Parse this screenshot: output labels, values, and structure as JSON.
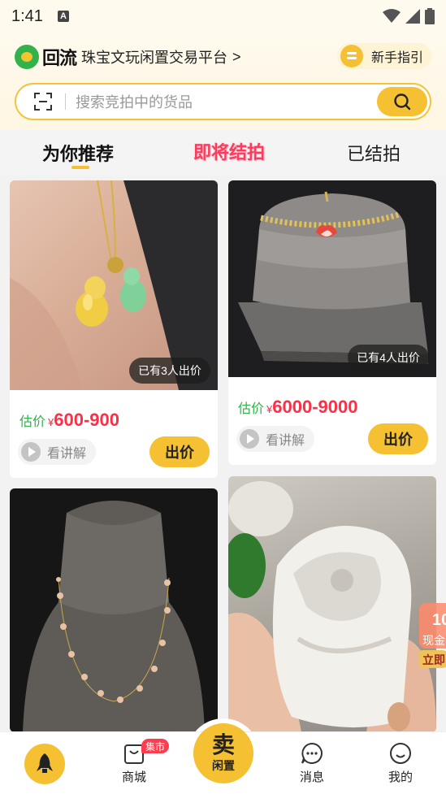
{
  "status_bar": {
    "time": "1:41",
    "notification_letter": "A"
  },
  "header": {
    "brand_name": "回流",
    "tagline": "珠宝文玩闲置交易平台",
    "chevron": ">",
    "guide_label": "新手指引"
  },
  "search": {
    "placeholder": "搜索竞拍中的货品"
  },
  "tabs": [
    {
      "label": "为你推荐",
      "active": true
    },
    {
      "label": "即将结拍",
      "active": false
    },
    {
      "label": "已结拍",
      "active": false
    }
  ],
  "cards": [
    {
      "image": "jade-gourd-pendant",
      "bid_count": "已有3人出价",
      "estimate_label": "估价",
      "currency": "¥",
      "price": "600-900",
      "explain_label": "看讲解",
      "bid_label": "出价"
    },
    {
      "image": "ruby-gold-bracelet",
      "bid_count": "已有4人出价",
      "estimate_label": "估价",
      "currency": "¥",
      "price": "6000-9000",
      "explain_label": "看讲解",
      "bid_label": "出价"
    },
    {
      "image": "pearl-necklace"
    },
    {
      "image": "white-jade-dragon-seal"
    }
  ],
  "float_widget": {
    "number": "10",
    "line1": "现金",
    "line2": "立即"
  },
  "bottom_nav": {
    "market_label": "商城",
    "market_badge": "集市",
    "sell_main": "卖",
    "sell_sub": "闲置",
    "messages_label": "消息",
    "mine_label": "我的"
  },
  "colors": {
    "accent": "#f5c132",
    "price": "#ff2e45",
    "estimate": "#2fb24a",
    "ending_tab": "#ff3a5a"
  }
}
